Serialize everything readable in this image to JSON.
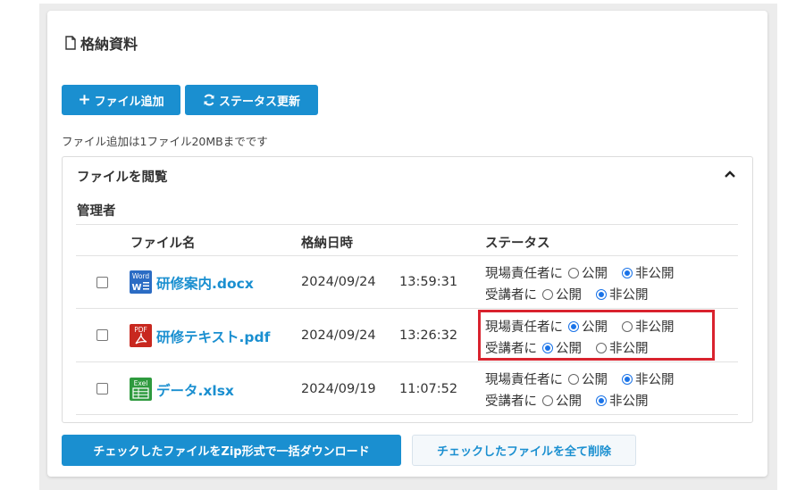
{
  "header": {
    "title": "格納資料",
    "icon": "document-icon"
  },
  "toolbar": {
    "add_file_label": "ファイル追加",
    "status_update_label": "ステータス更新"
  },
  "note": "ファイル追加は1ファイル20MBまでです",
  "panel": {
    "title": "ファイルを閲覧",
    "section": "管理者",
    "columns": {
      "name": "ファイル名",
      "date": "格納日時",
      "status": "ステータス"
    },
    "rows": [
      {
        "name": "研修案内.docx",
        "type": "word",
        "icon_label": "Word",
        "date": "2024/09/24",
        "time": "13:59:31",
        "manager_label": "現場責任者に",
        "manager_public": false,
        "trainee_label": "受講者に",
        "trainee_public": false
      },
      {
        "name": "研修テキスト.pdf",
        "type": "pdf",
        "icon_label": "PDF",
        "date": "2024/09/24",
        "time": "13:26:32",
        "manager_label": "現場責任者に",
        "manager_public": true,
        "trainee_label": "受講者に",
        "trainee_public": true
      },
      {
        "name": "データ.xlsx",
        "type": "excel",
        "icon_label": "Exel",
        "date": "2024/09/19",
        "time": "11:07:52",
        "manager_label": "現場責任者に",
        "manager_public": false,
        "trainee_label": "受講者に",
        "trainee_public": false
      }
    ],
    "public_label": "公開",
    "private_label": "非公開"
  },
  "footer": {
    "zip_label": "チェックしたファイルをZip形式で一括ダウンロード",
    "delete_label": "チェックしたファイルを全て削除"
  },
  "colors": {
    "primary": "#1a8fd0",
    "highlight": "#d9232e",
    "radio": "#1a73e8"
  }
}
